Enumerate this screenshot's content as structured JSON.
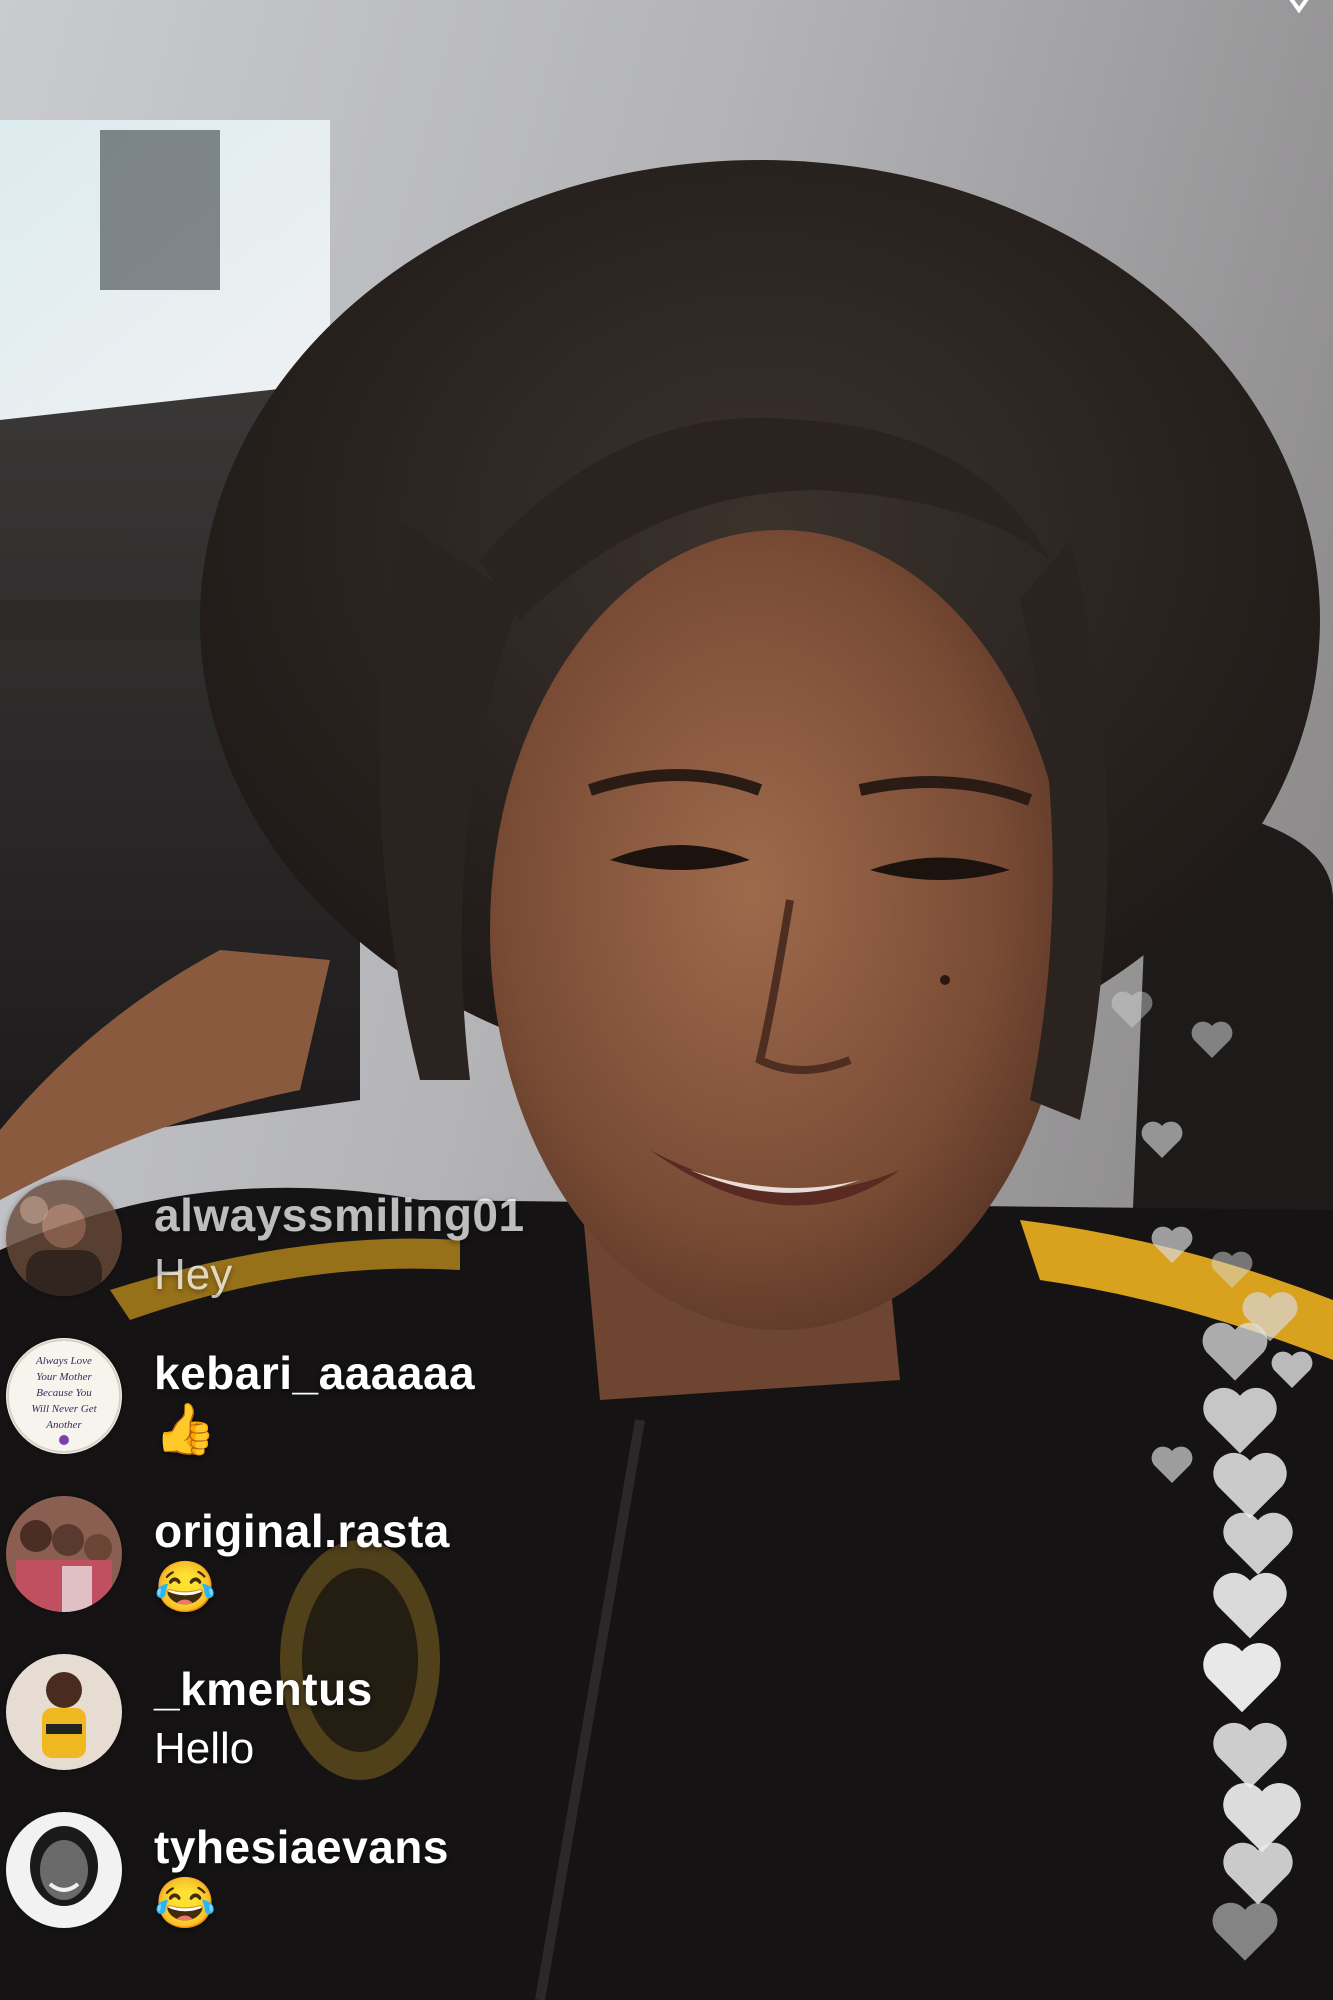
{
  "comments": [
    {
      "username": "alwayssmiling01",
      "message": "Hey",
      "avatar": "avatar-alwayssmiling01"
    },
    {
      "username": "kebari_aaaaaa",
      "message": "👍",
      "avatar": "avatar-kebari"
    },
    {
      "username": "original.rasta",
      "message": "😂",
      "avatar": "avatar-original-rasta"
    },
    {
      "username": "_kmentus",
      "message": "Hello",
      "avatar": "avatar-kmentus"
    },
    {
      "username": "tyhesiaevans",
      "message": "😂",
      "avatar": "avatar-tyhesiaevans"
    }
  ],
  "kebari_avatar_text": [
    "Always Love",
    "Your Mother",
    "Because You",
    "Will Never Get",
    "Another"
  ],
  "hearts_icon": "heart-icon",
  "colors": {
    "heart": "#d8d8d8",
    "jacket": "#151313",
    "stripe": "#d9a21e"
  }
}
